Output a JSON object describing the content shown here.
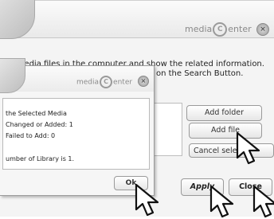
{
  "main": {
    "logo_left": "media",
    "logo_c": "C",
    "logo_right": "enter",
    "close_icon": "x-icon",
    "description_line1": "he media files in the computer and show the related information.",
    "description_line2": "on the Search Button.",
    "buttons": {
      "add_folder": "Add folder",
      "add_file": "Add file",
      "cancel_select": "Cancel select",
      "apply": "Apply",
      "close": "Close"
    }
  },
  "popup": {
    "logo_left": "media",
    "logo_c": "C",
    "logo_right": "enter",
    "lines": [
      "the Selected Media",
      "Changed or Added: 1",
      "Failed to Add: 0",
      "umber of Library is 1."
    ],
    "ok_label": "Ok"
  },
  "cursors": [
    "arrow-cursor-icon",
    "arrow-cursor-icon",
    "arrow-cursor-icon",
    "arrow-cursor-icon"
  ]
}
